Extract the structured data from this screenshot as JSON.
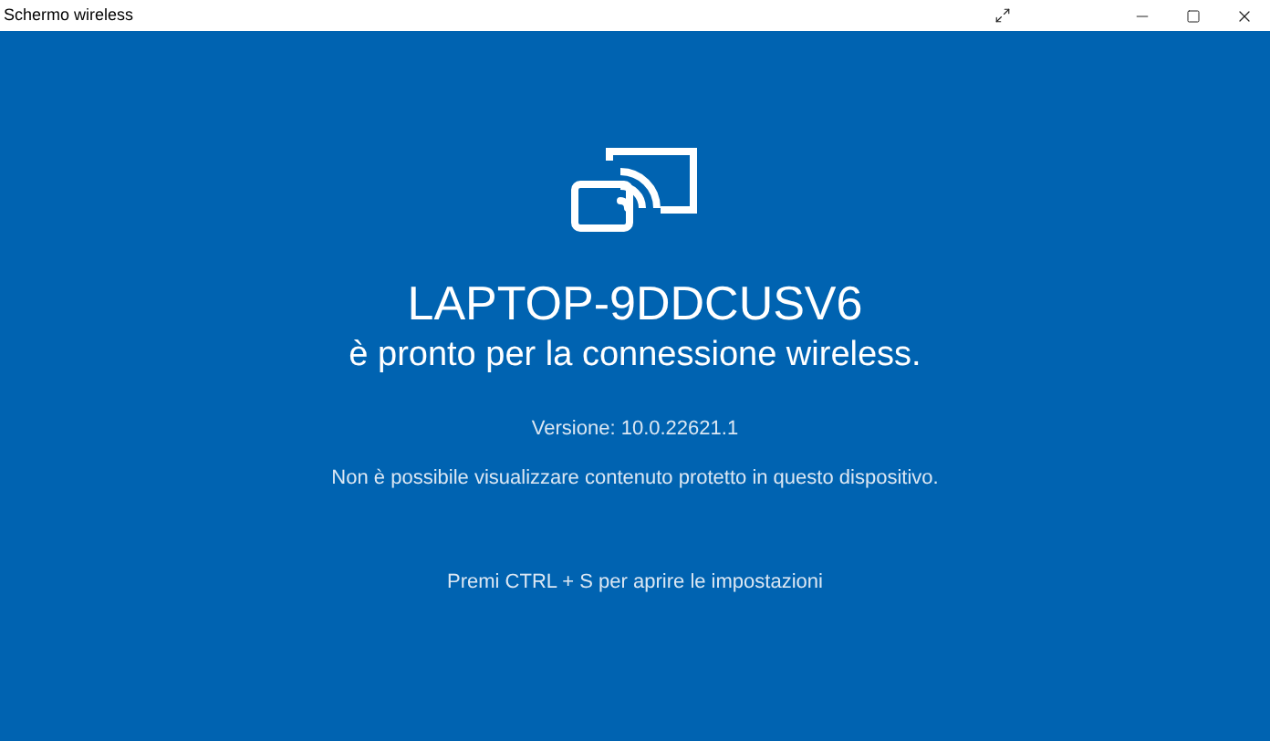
{
  "window": {
    "title": "Schermo wireless"
  },
  "device_name": "LAPTOP-9DDCUSV6",
  "status": "è pronto per la connessione wireless.",
  "version": "Versione: 10.0.22621.1",
  "protected_notice": "Non è possibile visualizzare contenuto protetto in questo dispositivo.",
  "settings_hint": "Premi CTRL + S per aprire le impostazioni"
}
